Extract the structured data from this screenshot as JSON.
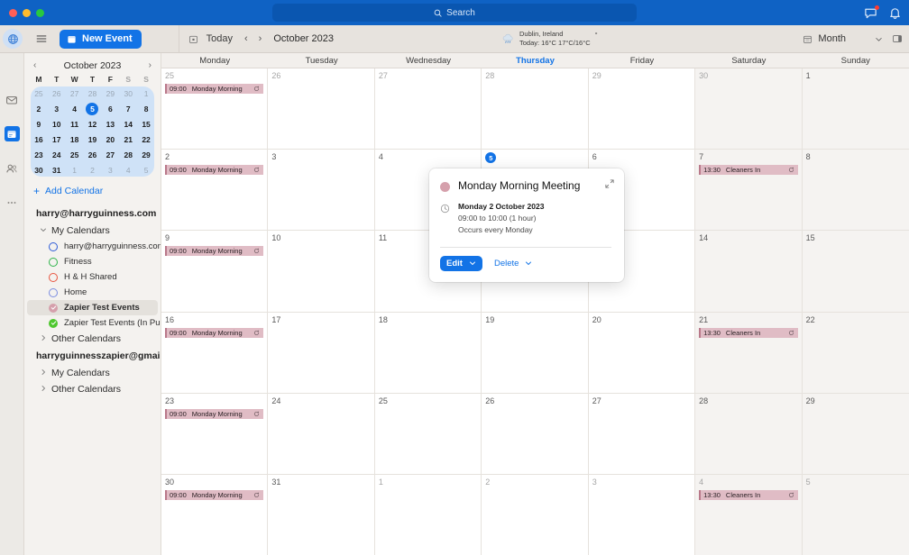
{
  "titlebar": {
    "search_placeholder": "Search",
    "icons": {
      "messages": "chat-icon",
      "notifications": "bell-icon"
    }
  },
  "toolbar": {
    "globe_icon": "globe-icon",
    "menu_icon": "hamburger-icon",
    "new_event_label": "New Event",
    "today_label": "Today",
    "prev_arrow": "‹",
    "next_arrow": "›",
    "month_label": "October 2023",
    "view_label": "Month",
    "weather": {
      "location": "Dublin, Ireland",
      "summary": "Today: 16°C  17°C/16°C",
      "degree_mark": "°"
    }
  },
  "rail": {
    "items": [
      {
        "name": "globe-icon",
        "active": false
      },
      {
        "name": "mail-icon",
        "active": false
      },
      {
        "name": "calendar-icon",
        "active": true
      },
      {
        "name": "people-icon",
        "active": false
      },
      {
        "name": "more-icon",
        "active": false
      }
    ]
  },
  "sidebar": {
    "mini_calendar": {
      "title": "October 2023",
      "prev": "‹",
      "next": "›",
      "dow": [
        "M",
        "T",
        "W",
        "T",
        "F",
        "S",
        "S"
      ],
      "weeks": [
        [
          {
            "d": "25",
            "m": true
          },
          {
            "d": "26",
            "m": true
          },
          {
            "d": "27",
            "m": true
          },
          {
            "d": "28",
            "m": true
          },
          {
            "d": "29",
            "m": true
          },
          {
            "d": "30",
            "m": true
          },
          {
            "d": "1",
            "m": true
          }
        ],
        [
          {
            "d": "2"
          },
          {
            "d": "3"
          },
          {
            "d": "4"
          },
          {
            "d": "5",
            "today": true
          },
          {
            "d": "6"
          },
          {
            "d": "7"
          },
          {
            "d": "8"
          }
        ],
        [
          {
            "d": "9"
          },
          {
            "d": "10"
          },
          {
            "d": "11"
          },
          {
            "d": "12"
          },
          {
            "d": "13"
          },
          {
            "d": "14"
          },
          {
            "d": "15"
          }
        ],
        [
          {
            "d": "16"
          },
          {
            "d": "17"
          },
          {
            "d": "18"
          },
          {
            "d": "19"
          },
          {
            "d": "20"
          },
          {
            "d": "21"
          },
          {
            "d": "22"
          }
        ],
        [
          {
            "d": "23"
          },
          {
            "d": "24"
          },
          {
            "d": "25"
          },
          {
            "d": "26"
          },
          {
            "d": "27"
          },
          {
            "d": "28"
          },
          {
            "d": "29"
          }
        ],
        [
          {
            "d": "30"
          },
          {
            "d": "31"
          },
          {
            "d": "1",
            "m": true
          },
          {
            "d": "2",
            "m": true
          },
          {
            "d": "3",
            "m": true
          },
          {
            "d": "4",
            "m": true
          },
          {
            "d": "5",
            "m": true
          }
        ]
      ]
    },
    "add_calendar_label": "Add Calendar",
    "accounts": [
      {
        "email": "harry@harryguinness.com",
        "expanded": true,
        "groups": [
          {
            "label": "My Calendars",
            "expanded": true,
            "calendars": [
              {
                "label": "harry@harryguinness.com",
                "color": "#2d5bd7",
                "checked": false,
                "selected": false
              },
              {
                "label": "Fitness",
                "color": "#2eb34a",
                "checked": false,
                "selected": false
              },
              {
                "label": "H & H Shared",
                "color": "#e8543f",
                "checked": false,
                "selected": false
              },
              {
                "label": "Home",
                "color": "#7a8ce0",
                "checked": false,
                "selected": false
              },
              {
                "label": "Zapier Test Events",
                "color": "#d5a0ac",
                "checked": true,
                "selected": true
              },
              {
                "label": "Zapier Test Events (In Purple)",
                "color": "#4fc72f",
                "checked": true,
                "selected": false
              }
            ]
          },
          {
            "label": "Other Calendars",
            "expanded": false,
            "calendars": []
          }
        ]
      },
      {
        "email": "harryguinnesszapier@gmail.com",
        "expanded": true,
        "groups": [
          {
            "label": "My Calendars",
            "expanded": false,
            "calendars": []
          },
          {
            "label": "Other Calendars",
            "expanded": false,
            "calendars": []
          }
        ]
      }
    ]
  },
  "calendar": {
    "day_headers": [
      "Monday",
      "Tuesday",
      "Wednesday",
      "Thursday",
      "Friday",
      "Saturday",
      "Sunday"
    ],
    "today_column_index": 3,
    "weeks": [
      [
        {
          "num": "25",
          "other": true,
          "events": [
            {
              "time": "09:00",
              "title": "Monday Morning",
              "recurring": true
            }
          ]
        },
        {
          "num": "26",
          "other": true,
          "events": []
        },
        {
          "num": "27",
          "other": true,
          "events": []
        },
        {
          "num": "28",
          "other": true,
          "events": []
        },
        {
          "num": "29",
          "other": true,
          "events": []
        },
        {
          "num": "30",
          "other": true,
          "weekend": true,
          "events": []
        },
        {
          "num": "1",
          "other": false,
          "weekend": true,
          "events": []
        }
      ],
      [
        {
          "num": "2",
          "events": [
            {
              "time": "09:00",
              "title": "Monday Morning",
              "recurring": true
            }
          ]
        },
        {
          "num": "3",
          "events": []
        },
        {
          "num": "4",
          "events": []
        },
        {
          "num": "5",
          "today": true,
          "events": []
        },
        {
          "num": "6",
          "events": []
        },
        {
          "num": "7",
          "weekend": true,
          "events": [
            {
              "time": "13:30",
              "title": "Cleaners In",
              "recurring": true
            }
          ]
        },
        {
          "num": "8",
          "weekend": true,
          "events": []
        }
      ],
      [
        {
          "num": "9",
          "events": [
            {
              "time": "09:00",
              "title": "Monday Morning",
              "recurring": true
            }
          ]
        },
        {
          "num": "10",
          "events": []
        },
        {
          "num": "11",
          "events": []
        },
        {
          "num": "12",
          "events": []
        },
        {
          "num": "13",
          "events": []
        },
        {
          "num": "14",
          "weekend": true,
          "events": []
        },
        {
          "num": "15",
          "weekend": true,
          "events": []
        }
      ],
      [
        {
          "num": "16",
          "events": [
            {
              "time": "09:00",
              "title": "Monday Morning",
              "recurring": true
            }
          ]
        },
        {
          "num": "17",
          "events": []
        },
        {
          "num": "18",
          "events": []
        },
        {
          "num": "19",
          "events": []
        },
        {
          "num": "20",
          "events": []
        },
        {
          "num": "21",
          "weekend": true,
          "events": [
            {
              "time": "13:30",
              "title": "Cleaners In",
              "recurring": true
            }
          ]
        },
        {
          "num": "22",
          "weekend": true,
          "events": []
        }
      ],
      [
        {
          "num": "23",
          "events": [
            {
              "time": "09:00",
              "title": "Monday Morning",
              "recurring": true
            }
          ]
        },
        {
          "num": "24",
          "events": []
        },
        {
          "num": "25",
          "events": []
        },
        {
          "num": "26",
          "events": []
        },
        {
          "num": "27",
          "events": []
        },
        {
          "num": "28",
          "weekend": true,
          "events": []
        },
        {
          "num": "29",
          "weekend": true,
          "events": []
        }
      ],
      [
        {
          "num": "30",
          "events": [
            {
              "time": "09:00",
              "title": "Monday Morning",
              "recurring": true
            }
          ]
        },
        {
          "num": "31",
          "events": []
        },
        {
          "num": "1",
          "other": true,
          "events": []
        },
        {
          "num": "2",
          "other": true,
          "events": []
        },
        {
          "num": "3",
          "other": true,
          "events": []
        },
        {
          "num": "4",
          "other": true,
          "weekend": true,
          "events": [
            {
              "time": "13:30",
              "title": "Cleaners In",
              "recurring": true
            }
          ]
        },
        {
          "num": "5",
          "other": true,
          "weekend": true,
          "events": []
        }
      ]
    ]
  },
  "popover": {
    "title": "Monday Morning Meeting",
    "date": "Monday 2 October 2023",
    "time": "09:00 to 10:00 (1 hour)",
    "recurrence": "Occurs every Monday",
    "edit_label": "Edit",
    "delete_label": "Delete",
    "dot_color": "#d5a0ac"
  },
  "colors": {
    "accent": "#1273e6",
    "titlebar": "#0f62c4",
    "event_chip": "#e0bcc5",
    "event_chip_stripe": "#b9798a"
  }
}
